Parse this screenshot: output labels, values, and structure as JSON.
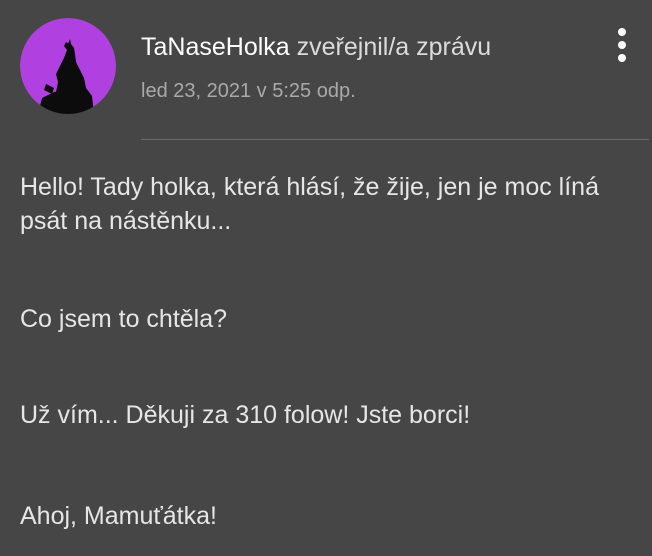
{
  "post": {
    "author": "TaNaseHolka",
    "action": "zveřejnil/a zprávu",
    "timestamp": "led 23, 2021 v 5:25 odp.",
    "paragraphs": [
      "Hello! Tady holka, která hlásí, že žije, jen je moc líná psát na nástěnku...",
      "Co jsem to chtěla?",
      "Už vím... Děkuji za 310 folow! Jste borci!",
      "Ahoj, Mamuťátka!"
    ]
  },
  "icons": {
    "avatar": "howling-wolf-icon",
    "menu": "more-vertical-icon"
  },
  "colors": {
    "background": "#464646",
    "avatar_bg": "#b040e0",
    "text": "#e6e6e6",
    "author": "#ffffff",
    "timestamp": "#a9a9a9",
    "divider": "#6b6b6b"
  }
}
